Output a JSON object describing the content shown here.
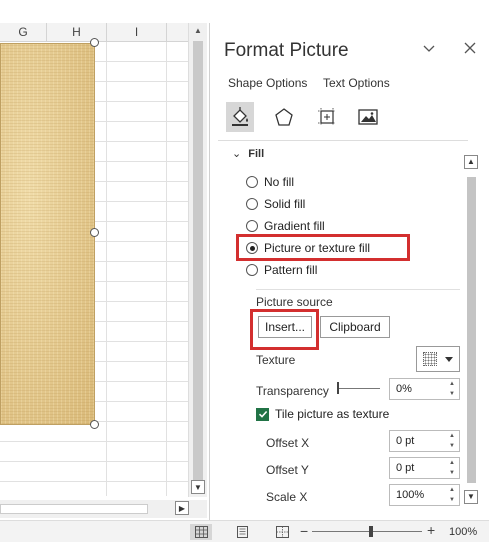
{
  "sheet": {
    "columns": [
      "G",
      "H",
      "I"
    ]
  },
  "pane": {
    "title": "Format Picture",
    "tabs": [
      "Shape Options",
      "Text Options"
    ],
    "icons": [
      "fill-line-icon",
      "effects-icon",
      "size-properties-icon",
      "picture-icon"
    ],
    "section_header": "Fill",
    "fill_options": [
      {
        "label": "No fill",
        "checked": false
      },
      {
        "label": "Solid fill",
        "checked": false
      },
      {
        "label": "Gradient fill",
        "checked": false
      },
      {
        "label": "Picture or texture fill",
        "checked": true
      },
      {
        "label": "Pattern fill",
        "checked": false
      }
    ],
    "picture_source_label": "Picture source",
    "insert_button": "Insert...",
    "clipboard_button": "Clipboard",
    "texture_label": "Texture",
    "transparency_label": "Transparency",
    "transparency_value": "0%",
    "tile_checkbox_label": "Tile picture as texture",
    "tile_checked": true,
    "offset_x_label": "Offset X",
    "offset_x_value": "0 pt",
    "offset_y_label": "Offset Y",
    "offset_y_value": "0 pt",
    "scale_x_label": "Scale X",
    "scale_x_value": "100%"
  },
  "statusbar": {
    "zoom_minus": "−",
    "zoom_plus": "+",
    "zoom_level": "100%"
  },
  "colors": {
    "highlight": "#d32f2f",
    "checkbox": "#217346"
  }
}
